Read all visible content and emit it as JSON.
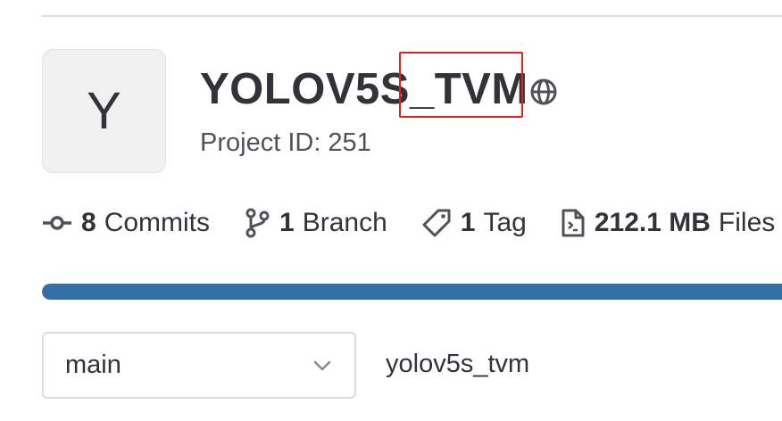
{
  "project": {
    "avatar_letter": "Y",
    "title": "YOLOV5S_TVM",
    "visibility_icon": "globe-icon",
    "id_text": "Project ID: 251"
  },
  "stats": {
    "commits": {
      "count": "8",
      "label": "Commits",
      "icon": "commit-icon"
    },
    "branches": {
      "count": "1",
      "label": "Branch",
      "icon": "branch-icon"
    },
    "tags": {
      "count": "1",
      "label": "Tag",
      "icon": "tag-icon"
    },
    "files": {
      "count": "212.1 MB",
      "label": "Files",
      "icon": "file-icon"
    }
  },
  "storage_bar": {
    "fill_fraction": 1.0,
    "color": "#3470a8"
  },
  "repo_nav": {
    "branch_selected": "main",
    "breadcrumb_root": "yolov5s_tvm"
  },
  "colors": {
    "highlight_box": "#e0221b",
    "text_primary": "#333238"
  }
}
